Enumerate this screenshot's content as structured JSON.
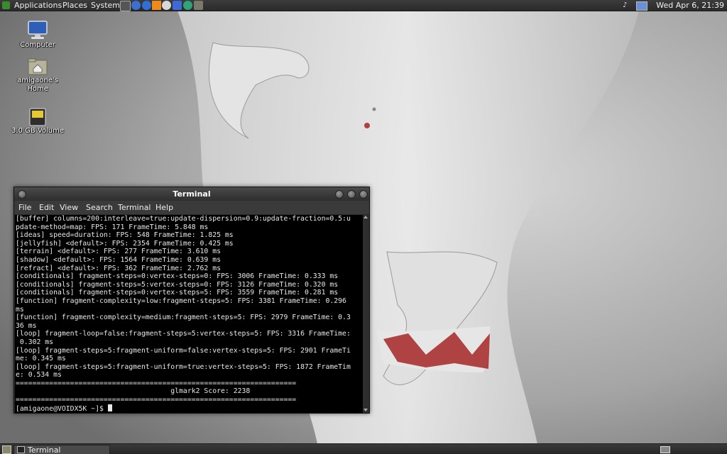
{
  "top_panel": {
    "menus": [
      "Applications",
      "Places",
      "System"
    ],
    "clock": "Wed Apr  6, 21:39"
  },
  "desktop": {
    "icons": [
      {
        "label": "Computer"
      },
      {
        "label": "amigaone's\nHome"
      },
      {
        "label": "3.0 GB Volume"
      }
    ]
  },
  "terminal": {
    "title": "Terminal",
    "menus": [
      "File",
      "Edit",
      "View",
      "Search",
      "Terminal",
      "Help"
    ],
    "lines": [
      "[buffer] columns=200:interleave=true:update-dispersion=0.9:update-fraction=0.5:u",
      "pdate-method=map: FPS: 171 FrameTime: 5.848 ms",
      "[ideas] speed=duration: FPS: 548 FrameTime: 1.825 ms",
      "[jellyfish] <default>: FPS: 2354 FrameTime: 0.425 ms",
      "[terrain] <default>: FPS: 277 FrameTime: 3.610 ms",
      "[shadow] <default>: FPS: 1564 FrameTime: 0.639 ms",
      "[refract] <default>: FPS: 362 FrameTime: 2.762 ms",
      "[conditionals] fragment-steps=0:vertex-steps=0: FPS: 3006 FrameTime: 0.333 ms",
      "[conditionals] fragment-steps=5:vertex-steps=0: FPS: 3126 FrameTime: 0.320 ms",
      "[conditionals] fragment-steps=0:vertex-steps=5: FPS: 3559 FrameTime: 0.281 ms",
      "[function] fragment-complexity=low:fragment-steps=5: FPS: 3381 FrameTime: 0.296",
      "ms",
      "[function] fragment-complexity=medium:fragment-steps=5: FPS: 2979 FrameTime: 0.3",
      "36 ms",
      "[loop] fragment-loop=false:fragment-steps=5:vertex-steps=5: FPS: 3316 FrameTime:",
      " 0.302 ms",
      "[loop] fragment-steps=5:fragment-uniform=false:vertex-steps=5: FPS: 2901 FrameTi",
      "me: 0.345 ms",
      "[loop] fragment-steps=5:fragment-uniform=true:vertex-steps=5: FPS: 1872 FrameTim",
      "e: 0.534 ms",
      "===================================================================",
      "                                     glmark2 Score: 2238",
      "==================================================================="
    ],
    "prompt": "[amigaone@VOIDX5K ~]$ "
  },
  "bottom_panel": {
    "task": "Terminal"
  }
}
